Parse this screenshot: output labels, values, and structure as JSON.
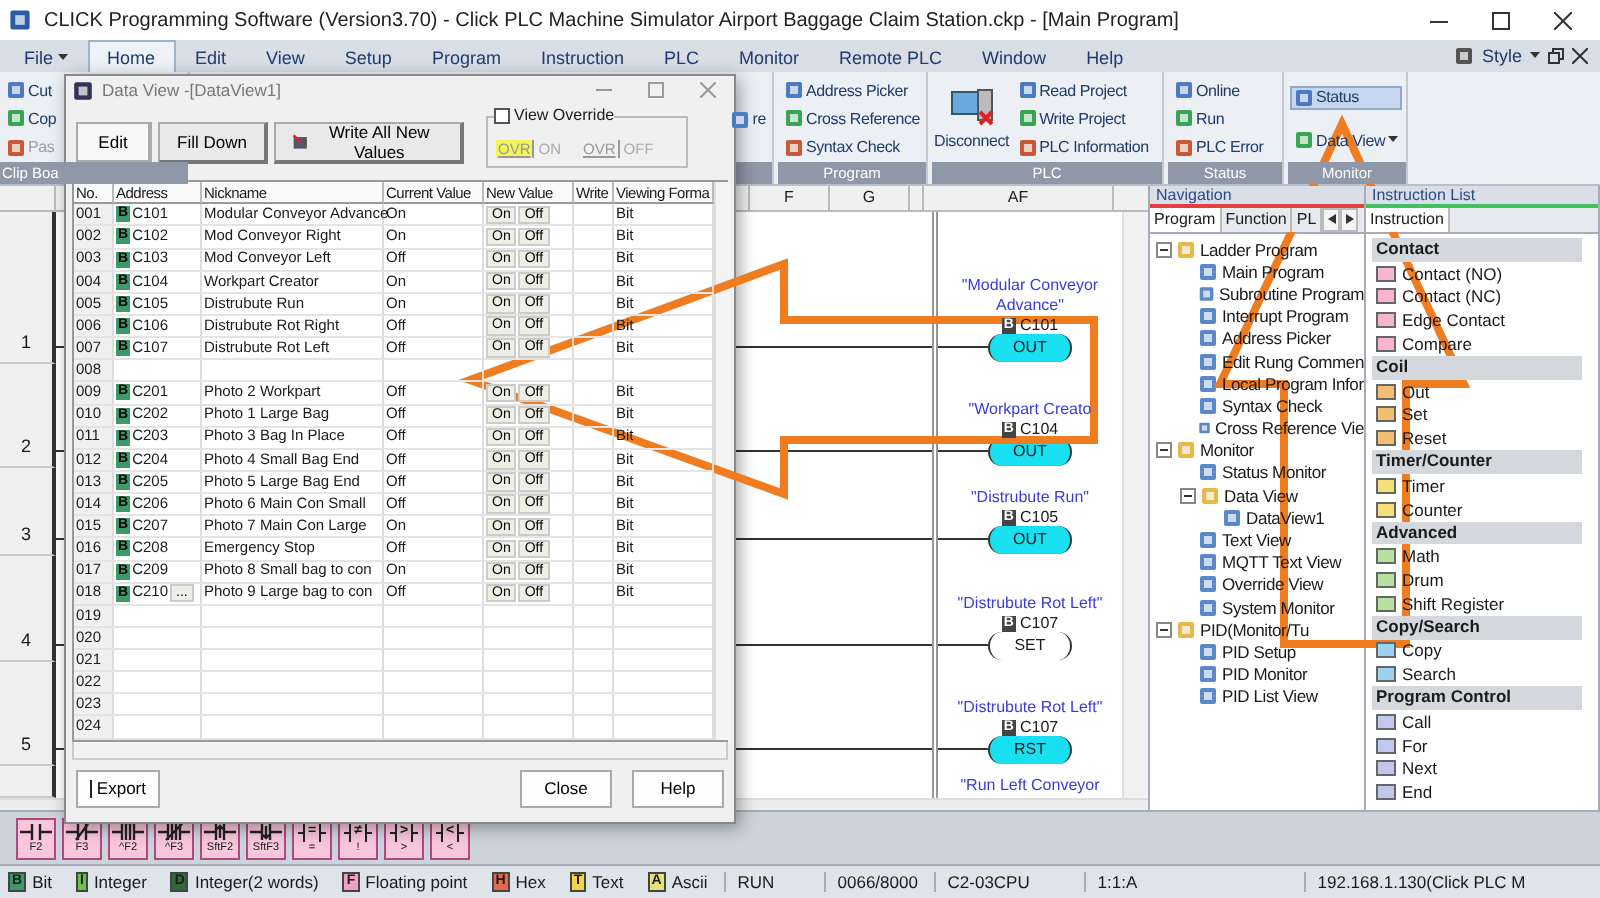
{
  "window": {
    "title": "CLICK Programming Software (Version3.70) - Click PLC Machine Simulator Airport Baggage Claim Station.ckp - [Main Program]"
  },
  "menu": [
    {
      "label": "File",
      "selected": false,
      "dropdown": true
    },
    {
      "label": "Home",
      "selected": true,
      "dropdown": false
    },
    {
      "label": "Edit",
      "selected": false,
      "dropdown": false
    },
    {
      "label": "View",
      "selected": false,
      "dropdown": false
    },
    {
      "label": "Setup",
      "selected": false,
      "dropdown": false
    },
    {
      "label": "Program",
      "selected": false,
      "dropdown": false
    },
    {
      "label": "Instruction",
      "selected": false,
      "dropdown": false
    },
    {
      "label": "PLC",
      "selected": false,
      "dropdown": false
    },
    {
      "label": "Monitor",
      "selected": false,
      "dropdown": false
    },
    {
      "label": "Remote PLC",
      "selected": false,
      "dropdown": false
    },
    {
      "label": "Window",
      "selected": false,
      "dropdown": false
    },
    {
      "label": "Help",
      "selected": false,
      "dropdown": false
    }
  ],
  "style_menu": {
    "label": "Style"
  },
  "ribbon": {
    "groups": [
      {
        "label": "Clip Boa",
        "items": [
          {
            "label": "Cut",
            "disabled": false
          },
          {
            "label": "Cop",
            "disabled": false
          },
          {
            "label": "Pas",
            "disabled": true
          }
        ]
      },
      {
        "items": [
          {
            "label": "re",
            "disabled": false
          }
        ]
      },
      {
        "label": "Program",
        "items": [
          {
            "label": "Address Picker",
            "disabled": false
          },
          {
            "label": "Cross Reference",
            "disabled": false
          },
          {
            "label": "Syntax Check",
            "disabled": false
          }
        ]
      },
      {
        "label": "PLC",
        "large": {
          "label": "Disconnect"
        },
        "items": [
          {
            "label": "Read Project",
            "disabled": false
          },
          {
            "label": "Write Project",
            "disabled": false
          },
          {
            "label": "PLC Information",
            "disabled": false
          }
        ]
      },
      {
        "label": "Status",
        "items": [
          {
            "label": "Online",
            "disabled": false
          },
          {
            "label": "Run",
            "disabled": false
          },
          {
            "label": "PLC Error",
            "disabled": false
          }
        ]
      },
      {
        "label": "Monitor",
        "items": [
          {
            "label": "Status",
            "disabled": false,
            "selected": true
          },
          {
            "label": "Data View",
            "disabled": false,
            "selected": false,
            "dropdown": true
          }
        ]
      }
    ]
  },
  "ladder": {
    "columns": [
      "F",
      "G",
      "AF"
    ],
    "rungs": [
      {
        "number": "1",
        "nickname": "\"Modular Conveyor Advance\"",
        "address": "C101",
        "type": "B",
        "instruction": "OUT",
        "energized": true
      },
      {
        "number": "2",
        "nickname": "\"Workpart Creato",
        "address": "C104",
        "type": "B",
        "instruction": "OUT",
        "energized": true
      },
      {
        "number": "3",
        "nickname": "\"Distrubute Run\"",
        "address": "C105",
        "type": "B",
        "instruction": "OUT",
        "energized": true
      },
      {
        "number": "4",
        "nickname": "\"Distrubute Rot Left\"",
        "address": "C107",
        "type": "B",
        "instruction": "SET",
        "energized": false
      },
      {
        "number": "5",
        "nickname": "\"Distrubute Rot Left\"",
        "address": "C107",
        "type": "B",
        "instruction": "RST",
        "energized": true
      },
      {
        "nickname": "\"Run Left Conveyor"
      }
    ]
  },
  "navigation": {
    "title": "Navigation",
    "tabs": [
      {
        "label": "Program",
        "selected": true
      },
      {
        "label": "Function",
        "selected": false
      },
      {
        "label": "PL",
        "selected": false
      }
    ],
    "tree": [
      {
        "label": "Ladder Program",
        "expanded": true,
        "children": [
          {
            "label": "Main Program"
          },
          {
            "label": "Subroutine Program"
          },
          {
            "label": "Interrupt Program"
          },
          {
            "label": "Address Picker"
          },
          {
            "label": "Edit Rung Commen"
          },
          {
            "label": "Local Program Infor"
          },
          {
            "label": "Syntax Check"
          },
          {
            "label": "Cross Reference Vie"
          }
        ]
      },
      {
        "label": "Monitor",
        "expanded": true,
        "children": [
          {
            "label": "Status Monitor"
          },
          {
            "label": "Data View",
            "expanded": true,
            "children": [
              {
                "label": "DataView1"
              }
            ]
          },
          {
            "label": "Text View"
          },
          {
            "label": "MQTT Text View"
          },
          {
            "label": "Override View"
          },
          {
            "label": "System Monitor"
          }
        ]
      },
      {
        "label": "PID(Monitor/Tu",
        "expanded": true,
        "children": [
          {
            "label": "PID Setup"
          },
          {
            "label": "PID Monitor"
          },
          {
            "label": "PID List View"
          }
        ]
      }
    ]
  },
  "instruction_list": {
    "title": "Instruction List",
    "tab": "Instruction",
    "sections": [
      {
        "title": "Contact",
        "kind": "contact",
        "items": [
          "Contact (NO)",
          "Contact (NC)",
          "Edge Contact",
          "Compare"
        ]
      },
      {
        "title": "Coil",
        "kind": "coil",
        "items": [
          "Out",
          "Set",
          "Reset"
        ]
      },
      {
        "title": "Timer/Counter",
        "kind": "timer",
        "items": [
          "Timer",
          "Counter"
        ]
      },
      {
        "title": "Advanced",
        "kind": "advanced",
        "items": [
          "Math",
          "Drum",
          "Shift Register"
        ]
      },
      {
        "title": "Copy/Search",
        "kind": "copy",
        "items": [
          "Copy",
          "Search"
        ]
      },
      {
        "title": "Program Control",
        "kind": "control",
        "items": [
          "Call",
          "For",
          "Next",
          "End"
        ]
      }
    ]
  },
  "toolbar": [
    {
      "kind": "no",
      "key": "F2"
    },
    {
      "kind": "nc",
      "key": "F3"
    },
    {
      "kind": "no_edge",
      "key": "^F2"
    },
    {
      "kind": "nc_edge",
      "key": "^F3"
    },
    {
      "kind": "rise",
      "key": "SftF2"
    },
    {
      "kind": "fall",
      "key": "SftF3"
    },
    {
      "kind": "compare",
      "op": "=",
      "key": "="
    },
    {
      "kind": "compare",
      "op": "≠",
      "key": "!"
    },
    {
      "kind": "compare",
      "op": ">",
      "key": ">"
    },
    {
      "kind": "compare",
      "op": "<",
      "key": "<"
    }
  ],
  "status_bar": {
    "types": [
      {
        "letter": "B",
        "label": "Bit",
        "color": "#3c9a6a"
      },
      {
        "letter": "I",
        "label": "Integer",
        "color": "#6cc24a"
      },
      {
        "letter": "D",
        "label": "Integer(2 words)",
        "color": "#2f6b3a"
      },
      {
        "letter": "F",
        "label": "Floating point",
        "color": "#f2a0c0"
      },
      {
        "letter": "H",
        "label": "Hex",
        "color": "#e06a50"
      },
      {
        "letter": "T",
        "label": "Text",
        "color": "#f3d34a"
      },
      {
        "letter": "A",
        "label": "Ascii",
        "color": "#e4e27a"
      }
    ],
    "fields": [
      "RUN",
      "0066/8000",
      "C2-03CPU",
      "1:1:A",
      "192.168.1.130(Click PLC M"
    ]
  },
  "data_view": {
    "title": "Data View -[DataView1]",
    "buttons": [
      {
        "label": "Edit",
        "selected": true
      },
      {
        "label": "Fill Down",
        "selected": false
      },
      {
        "label": "Write All New Values",
        "selected": false,
        "icon": true
      }
    ],
    "override": {
      "label": "View Override",
      "checked": false,
      "on": {
        "tag": "OVR",
        "label": "ON",
        "highlighted": true
      },
      "off": {
        "tag": "OVR",
        "label": "OFF",
        "highlighted": false
      }
    },
    "columns": [
      "No.",
      "Address",
      "Nickname",
      "Current Value",
      "New Value",
      "Write",
      "Viewing Forma"
    ],
    "rows": [
      {
        "no": "001",
        "type": "B",
        "address": "C101",
        "nickname": "Modular Conveyor Advance",
        "current": "On",
        "new_value": [
          "On",
          "Off"
        ],
        "format": "Bit"
      },
      {
        "no": "002",
        "type": "B",
        "address": "C102",
        "nickname": "Mod Conveyor Right",
        "current": "On",
        "new_value": [
          "On",
          "Off"
        ],
        "format": "Bit"
      },
      {
        "no": "003",
        "type": "B",
        "address": "C103",
        "nickname": "Mod Conveyor Left",
        "current": "Off",
        "new_value": [
          "On",
          "Off"
        ],
        "format": "Bit"
      },
      {
        "no": "004",
        "type": "B",
        "address": "C104",
        "nickname": "Workpart Creator",
        "current": "On",
        "new_value": [
          "On",
          "Off"
        ],
        "format": "Bit"
      },
      {
        "no": "005",
        "type": "B",
        "address": "C105",
        "nickname": "Distrubute Run",
        "current": "On",
        "new_value": [
          "On",
          "Off"
        ],
        "format": "Bit"
      },
      {
        "no": "006",
        "type": "B",
        "address": "C106",
        "nickname": "Distrubute Rot Right",
        "current": "Off",
        "new_value": [
          "On",
          "Off"
        ],
        "format": "Bit"
      },
      {
        "no": "007",
        "type": "B",
        "address": "C107",
        "nickname": "Distrubute Rot Left",
        "current": "Off",
        "new_value": [
          "On",
          "Off"
        ],
        "format": "Bit"
      },
      {
        "no": "008"
      },
      {
        "no": "009",
        "type": "B",
        "address": "C201",
        "nickname": "Photo 2 Workpart",
        "current": "Off",
        "new_value": [
          "On",
          "Off"
        ],
        "format": "Bit"
      },
      {
        "no": "010",
        "type": "B",
        "address": "C202",
        "nickname": "Photo 1 Large Bag",
        "current": "Off",
        "new_value": [
          "On",
          "Off"
        ],
        "format": "Bit"
      },
      {
        "no": "011",
        "type": "B",
        "address": "C203",
        "nickname": "Photo 3 Bag In Place",
        "current": "Off",
        "new_value": [
          "On",
          "Off"
        ],
        "format": "Bit"
      },
      {
        "no": "012",
        "type": "B",
        "address": "C204",
        "nickname": "Photo 4 Small Bag End",
        "current": "Off",
        "new_value": [
          "On",
          "Off"
        ],
        "format": "Bit"
      },
      {
        "no": "013",
        "type": "B",
        "address": "C205",
        "nickname": "Photo 5 Large Bag End",
        "current": "Off",
        "new_value": [
          "On",
          "Off"
        ],
        "format": "Bit"
      },
      {
        "no": "014",
        "type": "B",
        "address": "C206",
        "nickname": "Photo 6 Main Con Small",
        "current": "Off",
        "new_value": [
          "On",
          "Off"
        ],
        "format": "Bit"
      },
      {
        "no": "015",
        "type": "B",
        "address": "C207",
        "nickname": "Photo 7 Main Con Large",
        "current": "On",
        "new_value": [
          "On",
          "Off"
        ],
        "format": "Bit"
      },
      {
        "no": "016",
        "type": "B",
        "address": "C208",
        "nickname": "Emergency Stop",
        "current": "Off",
        "new_value": [
          "On",
          "Off"
        ],
        "format": "Bit"
      },
      {
        "no": "017",
        "type": "B",
        "address": "C209",
        "nickname": "Photo 8 Small bag to con",
        "current": "On",
        "new_value": [
          "On",
          "Off"
        ],
        "format": "Bit"
      },
      {
        "no": "018",
        "type": "B",
        "address": "C210",
        "browse": "...",
        "nickname": "Photo 9 Large bag to con",
        "current": "Off",
        "new_value": [
          "On",
          "Off"
        ],
        "format": "Bit"
      },
      {
        "no": "019"
      },
      {
        "no": "020"
      },
      {
        "no": "021"
      },
      {
        "no": "022"
      },
      {
        "no": "023"
      },
      {
        "no": "024"
      }
    ],
    "footer": {
      "export": "Export",
      "close": "Close",
      "help": "Help"
    }
  }
}
